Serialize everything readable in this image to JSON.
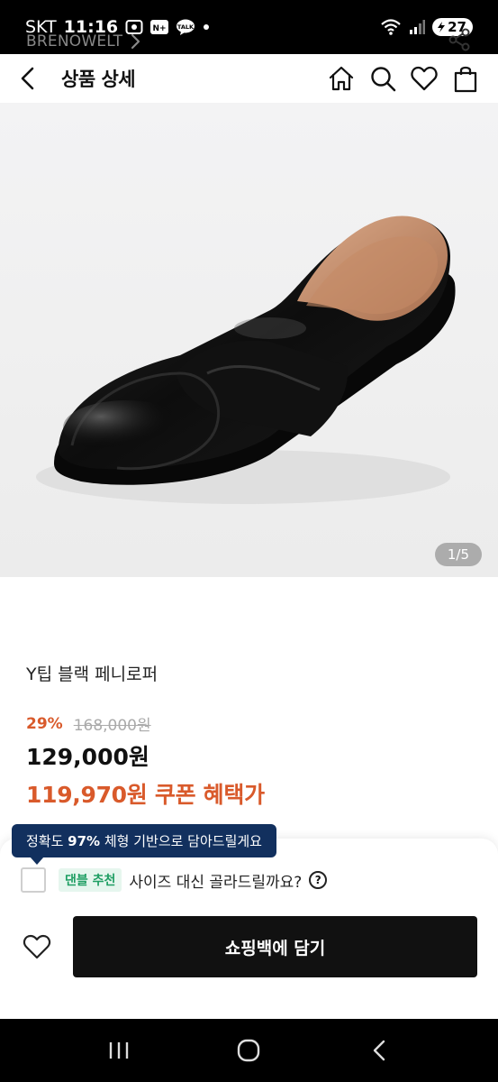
{
  "status_bar": {
    "carrier": "SKT",
    "time": "11:16",
    "battery": "27",
    "icons": [
      "screenshot-icon",
      "naver-icon",
      "kakaotalk-icon",
      "dot-icon",
      "wifi-icon",
      "signal-icon",
      "battery-icon"
    ]
  },
  "app_bar": {
    "title": "상품 상세",
    "icons": [
      "back-icon",
      "home-icon",
      "search-icon",
      "heart-icon",
      "shopping-bag-icon"
    ]
  },
  "hero": {
    "page_indicator": "1/5"
  },
  "product": {
    "brand": "BRENOWELT",
    "name": "Y팁 블랙 페니로퍼",
    "discount": "29%",
    "original_price": "168,000원",
    "price": "129,000원",
    "coupon_price": "119,970원 쿠폰 혜택가"
  },
  "size_recommend": {
    "tooltip_prefix": "정확도 ",
    "tooltip_accuracy": "97%",
    "tooltip_suffix": " 체형 기반으로 담아드릴게요",
    "badge": "댄블 추천",
    "text": "사이즈 대신 골라드릴까요?",
    "help": "?"
  },
  "actions": {
    "add_to_cart": "쇼핑백에 담기"
  },
  "colors": {
    "accent": "#d95a2b",
    "tooltip_bg": "#12305e",
    "badge_green": "#1f9e63",
    "button_bg": "#111111"
  }
}
